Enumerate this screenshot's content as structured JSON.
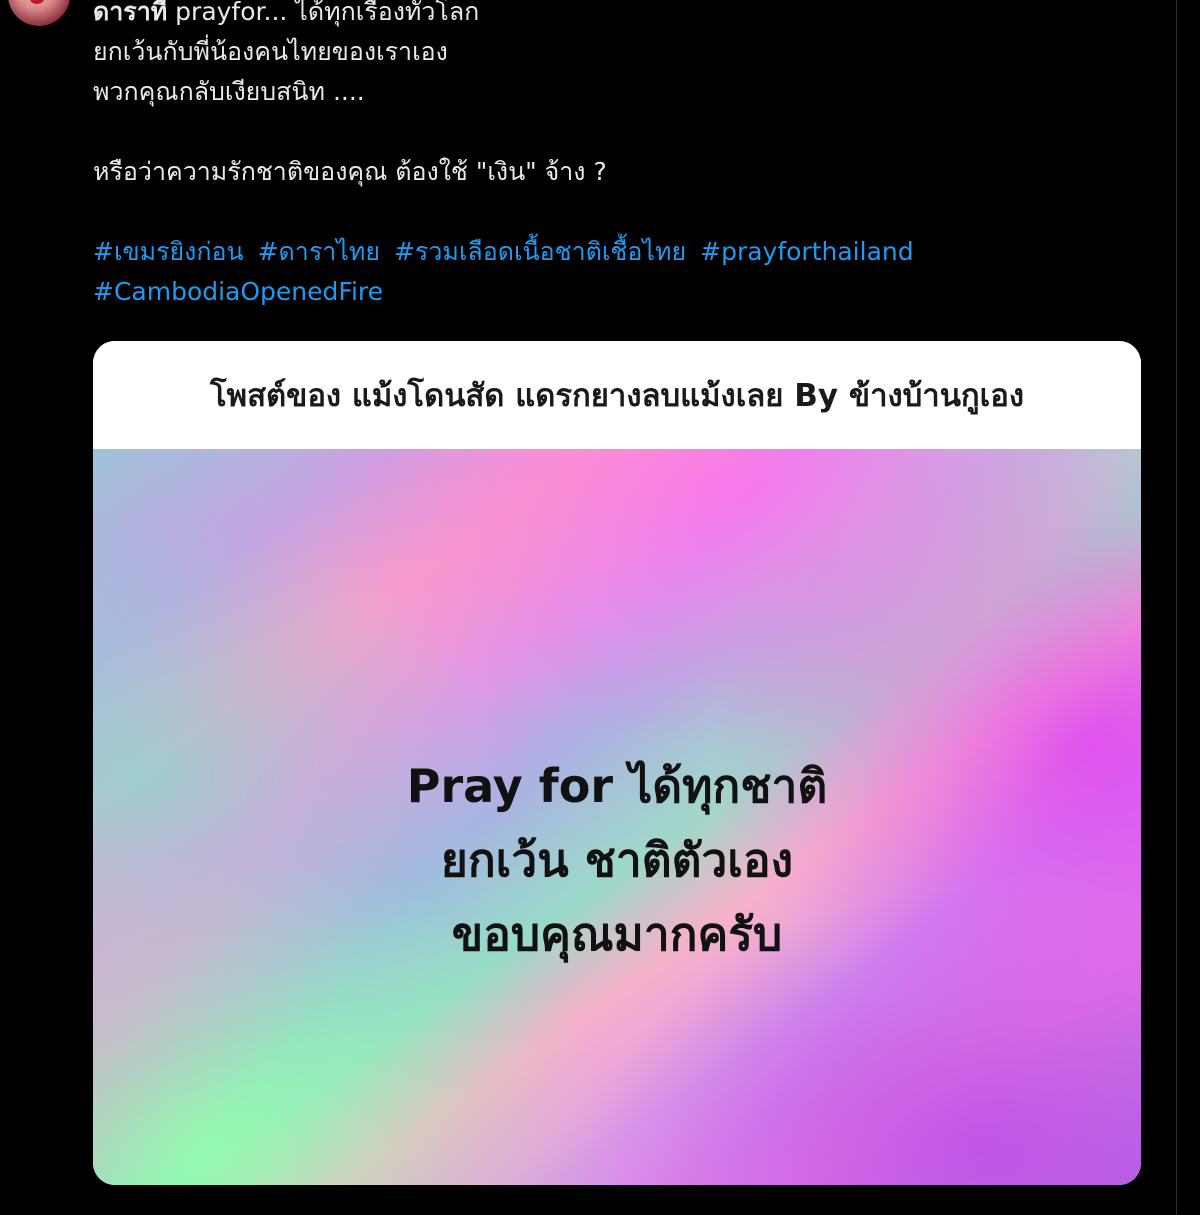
{
  "tweet": {
    "author_name": "ดาราที่",
    "line1_rest": " prayfor... ได้ทุกเรื่องทั่วโลก",
    "line2": "ยกเว้นกับพี่น้องคนไทยของเราเอง",
    "line3": "พวกคุณกลับเงียบสนิท ....",
    "line4": "หรือว่าความรักชาติของคุณ ต้องใช้ \"เงิน\" จ้าง ?",
    "hashtags": [
      "#เขมรยิงก่อน",
      "#ดาราไทย",
      "#รวมเลือดเนื้อชาติเชื้อไทย",
      "#prayforthailand",
      "#CambodiaOpenedFire"
    ]
  },
  "media_card": {
    "header": "โพสต์ของ แม้งโดนสัด แดรกยางลบแม้งเลย By ข้างบ้านกูเอง",
    "image_text": [
      "Pray for ได้ทุกชาติ",
      "ยกเว้น ชาติตัวเอง",
      "ขอบคุณมากครับ"
    ]
  },
  "colors": {
    "background": "#000000",
    "text": "#e7e9ea",
    "hashtag": "#1d9bf0",
    "card_header_bg": "#ffffff"
  },
  "icons": {
    "avatar": "user-avatar"
  }
}
